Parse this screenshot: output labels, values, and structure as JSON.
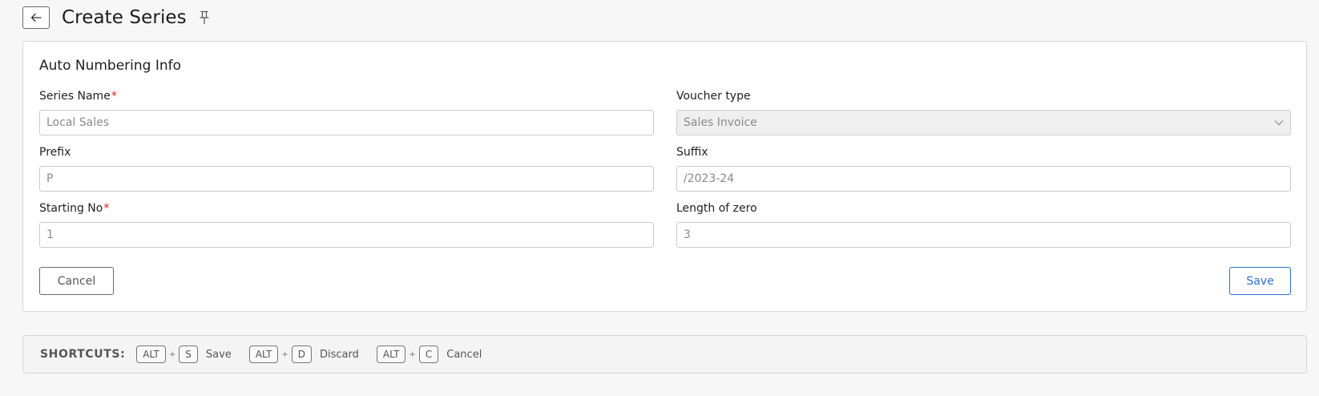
{
  "header": {
    "title": "Create Series"
  },
  "form": {
    "section_title": "Auto Numbering Info",
    "series_name": {
      "label": "Series Name",
      "required_mark": "*",
      "value": "Local Sales"
    },
    "voucher_type": {
      "label": "Voucher type",
      "value": "Sales Invoice"
    },
    "prefix": {
      "label": "Prefix",
      "value": "P"
    },
    "suffix": {
      "label": "Suffix",
      "value": "/2023-24"
    },
    "starting_no": {
      "label": "Starting No",
      "required_mark": "*",
      "value": "1"
    },
    "length_of_zero": {
      "label": "Length of zero",
      "value": "3"
    },
    "cancel_label": "Cancel",
    "save_label": "Save"
  },
  "shortcuts": {
    "title": "SHORTCUTS:",
    "plus": "+",
    "items": [
      {
        "mod": "ALT",
        "key": "S",
        "label": "Save"
      },
      {
        "mod": "ALT",
        "key": "D",
        "label": "Discard"
      },
      {
        "mod": "ALT",
        "key": "C",
        "label": "Cancel"
      }
    ]
  },
  "colors": {
    "accent": "#2a6fd6",
    "required": "#d42020",
    "page_bg": "#f7f7f7"
  },
  "icons": {
    "back": "arrow-left-icon",
    "pin": "pin-icon",
    "dropdown": "chevron-down-icon"
  }
}
